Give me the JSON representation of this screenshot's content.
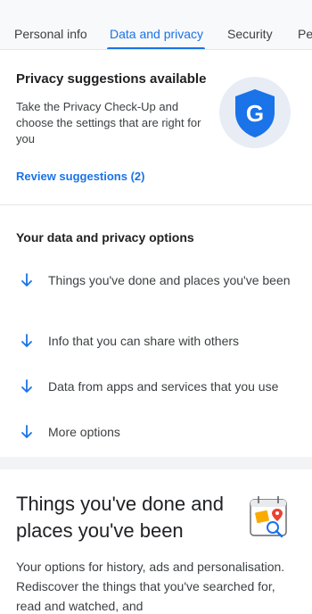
{
  "tabs": [
    {
      "label": "Personal info"
    },
    {
      "label": "Data and privacy"
    },
    {
      "label": "Security"
    },
    {
      "label": "Pe"
    }
  ],
  "active_tab": "Data and privacy",
  "suggestions": {
    "title": "Privacy suggestions available",
    "description": "Take the Privacy Check-Up and choose the settings that are right for you",
    "link": "Review suggestions (2)",
    "shield_letter": "G"
  },
  "options": {
    "title": "Your data and privacy options",
    "items": [
      {
        "label": "Things you've done and places you've been",
        "icon": "arrow-down-icon"
      },
      {
        "label": "Info that you can share with others",
        "icon": "arrow-down-icon"
      },
      {
        "label": "Data from apps and services that you use",
        "icon": "arrow-down-icon"
      },
      {
        "label": "More options",
        "icon": "arrow-down-icon"
      }
    ]
  },
  "done_section": {
    "title": "Things you've done and places you've been",
    "description": "Your options for history, ads and personalisation. Rediscover the things that you've searched for, read and watched, and"
  },
  "colors": {
    "accent": "#1a73e8",
    "shield": "#1a73e8",
    "text": "#202124"
  }
}
